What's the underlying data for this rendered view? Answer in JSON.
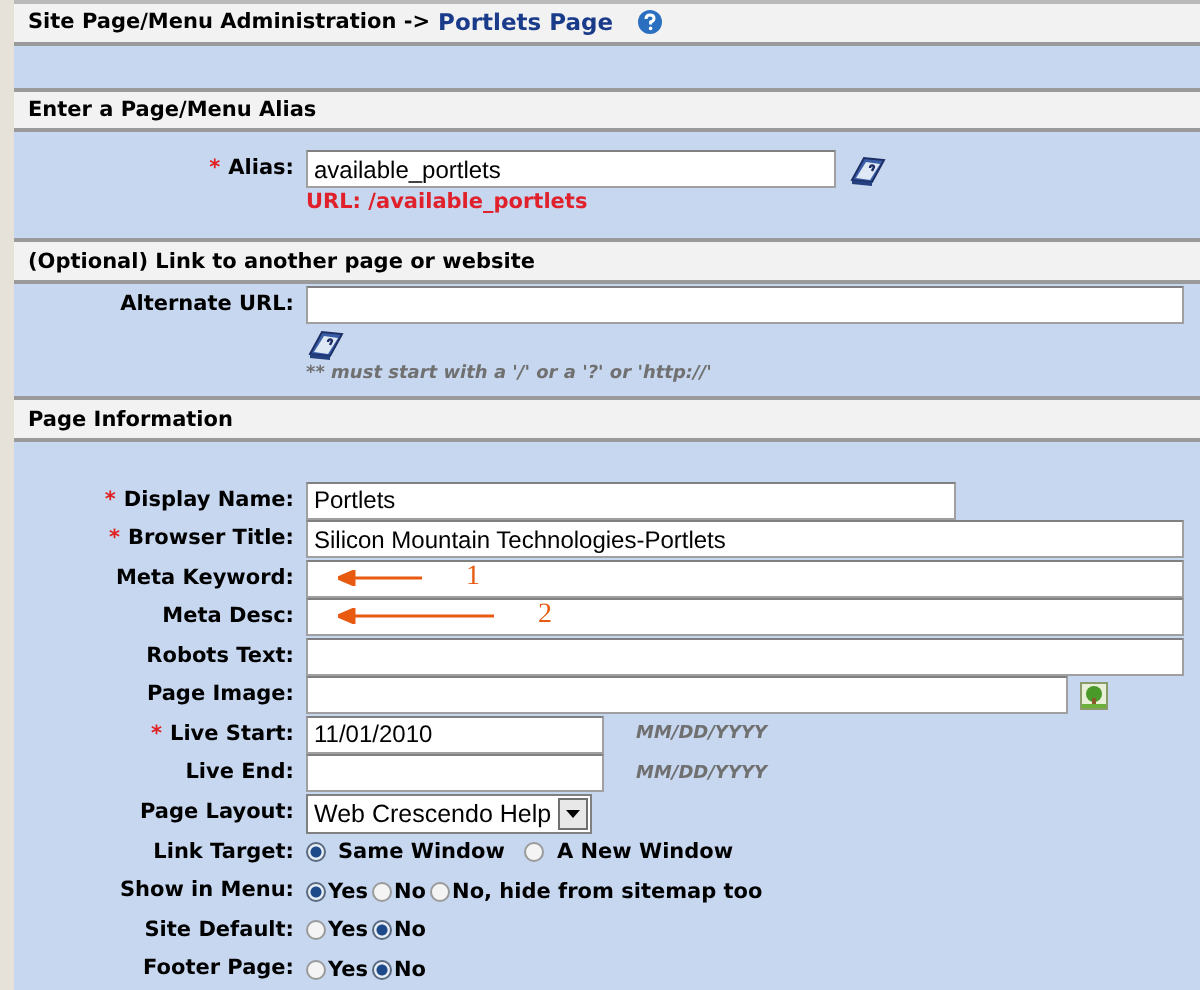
{
  "title": {
    "path": "Site Page/Menu Administration ->",
    "page": "Portlets Page"
  },
  "sections": [
    {
      "title": "Enter a Page/Menu Alias",
      "rows": [
        {
          "kind": "alias",
          "label": "Alias:",
          "required_mark": "*",
          "value": "available_portlets",
          "note": "URL: /available_portlets"
        }
      ]
    },
    {
      "title": "(Optional) Link to another page or website",
      "rows": [
        {
          "kind": "link",
          "label": "Alternate URL:",
          "value": "",
          "note": "** must start with a '/' or a '?' or 'http://'"
        }
      ]
    },
    {
      "title": "Page Information",
      "rows": [
        {
          "kind": "narrow",
          "label": "Display Name:",
          "required_mark": "*",
          "value": "Portlets"
        },
        {
          "kind": "wide",
          "label": "Browser Title:",
          "required_mark": "*",
          "value": "Silicon Mountain Technologies-Portlets"
        },
        {
          "kind": "wide",
          "label": "Meta Keyword:",
          "value": "",
          "annotation": "1"
        },
        {
          "kind": "wide",
          "label": "Meta Desc:",
          "value": "",
          "annotation": "2"
        },
        {
          "kind": "wide",
          "label": "Robots Text:",
          "value": ""
        },
        {
          "kind": "image",
          "label": "Page Image:",
          "value": ""
        },
        {
          "kind": "date",
          "label": "Live Start:",
          "required_mark": "*",
          "value": "11/01/2010",
          "hint": "MM/DD/YYYY"
        },
        {
          "kind": "date",
          "label": "Live End:",
          "value": "",
          "hint": "MM/DD/YYYY"
        },
        {
          "kind": "select",
          "label": "Page Layout:",
          "value": "Web Crescendo Help"
        },
        {
          "kind": "radio",
          "label": "Link Target:",
          "options": [
            {
              "label": "Same Window",
              "selected": true
            },
            {
              "label": "A New Window",
              "selected": false
            }
          ]
        },
        {
          "kind": "radio",
          "label": "Show in Menu:",
          "options": [
            {
              "label": "Yes",
              "selected": true
            },
            {
              "label": "No",
              "selected": false
            },
            {
              "label": "No, hide from sitemap too",
              "selected": false
            }
          ]
        },
        {
          "kind": "radio",
          "label": "Site Default:",
          "options": [
            {
              "label": "Yes",
              "selected": false
            },
            {
              "label": "No",
              "selected": true
            }
          ]
        },
        {
          "kind": "radio",
          "label": "Footer Page:",
          "options": [
            {
              "label": "Yes",
              "selected": false
            },
            {
              "label": "No",
              "selected": true
            }
          ]
        }
      ]
    }
  ]
}
